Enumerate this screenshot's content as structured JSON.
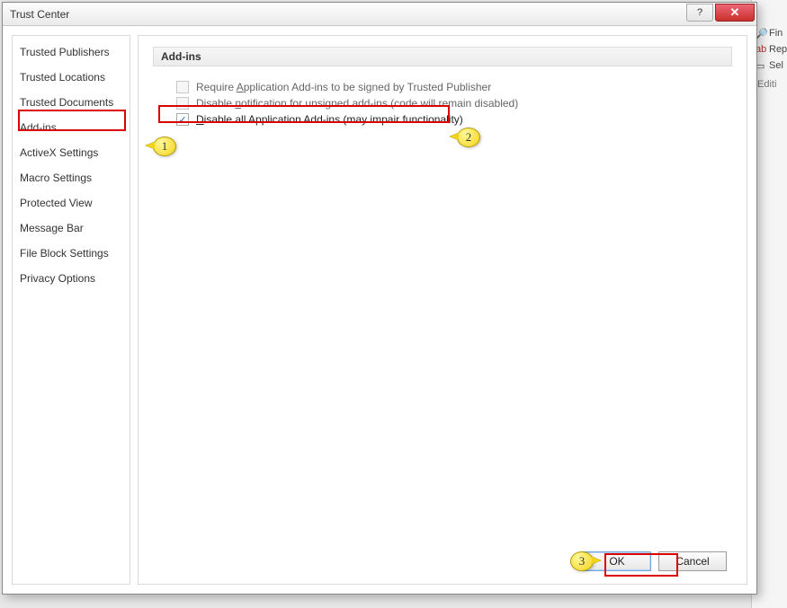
{
  "window": {
    "title": "Trust Center",
    "help_tooltip": "?",
    "close_tooltip": "✕"
  },
  "sidebar": {
    "items": [
      {
        "label": "Trusted Publishers"
      },
      {
        "label": "Trusted Locations"
      },
      {
        "label": "Trusted Documents"
      },
      {
        "label": "Add-ins",
        "selected": true
      },
      {
        "label": "ActiveX Settings"
      },
      {
        "label": "Macro Settings"
      },
      {
        "label": "Protected View"
      },
      {
        "label": "Message Bar"
      },
      {
        "label": "File Block Settings"
      },
      {
        "label": "Privacy Options"
      }
    ]
  },
  "section": {
    "header": "Add-ins",
    "options": [
      {
        "label_pre": "Require ",
        "u": "A",
        "label_post": "pplication Add-ins to be signed by Trusted Publisher",
        "checked": false,
        "disabled": true
      },
      {
        "label_pre": "Disable ",
        "u": "n",
        "label_post": "otification for unsigned add-ins (code will remain disabled)",
        "checked": false,
        "disabled": true
      },
      {
        "label_pre": "",
        "u": "D",
        "label_post": "isable all Application Add-ins (may impair functionality)",
        "checked": true,
        "disabled": false
      }
    ]
  },
  "buttons": {
    "ok": "OK",
    "cancel": "Cancel"
  },
  "callouts": {
    "c1": "1",
    "c2": "2",
    "c3": "3"
  },
  "bg": {
    "find": "Fin",
    "replace": "Rep",
    "select": "Sel",
    "group": "Editi"
  }
}
